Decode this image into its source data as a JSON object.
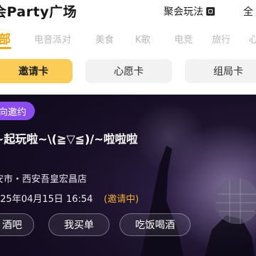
{
  "header": {
    "title": "会Party广场",
    "rules_label": "聚会玩法",
    "rules_icon": "document-icon",
    "right_text": "全"
  },
  "tabs": [
    {
      "label": "部",
      "active": true
    },
    {
      "label": "电音派对",
      "active": false
    },
    {
      "label": "美食",
      "active": false
    },
    {
      "label": "K歌",
      "active": false
    },
    {
      "label": "电竞",
      "active": false
    },
    {
      "label": "旅行",
      "active": false
    },
    {
      "label": "心",
      "active": false
    }
  ],
  "segments": [
    {
      "label": "邀请卡",
      "active": true
    },
    {
      "label": "心愿卡",
      "active": false
    },
    {
      "label": "组局卡",
      "active": false
    }
  ],
  "card": {
    "badge": "向邀约",
    "title": "~起玩啦~\\(≧▽≦)/~啦啦啦",
    "location": "安市・西安吾皇宏昌店",
    "time": "025年04月15日 16:54",
    "status": "(邀请中)",
    "chips": [
      "酒吧",
      "我买单",
      "吃饭喝酒"
    ]
  },
  "colors": {
    "accent": "#f5a60b",
    "active_segment": "#fbcd57",
    "badge": "#8a4cf0",
    "status": "#f2b12b"
  }
}
